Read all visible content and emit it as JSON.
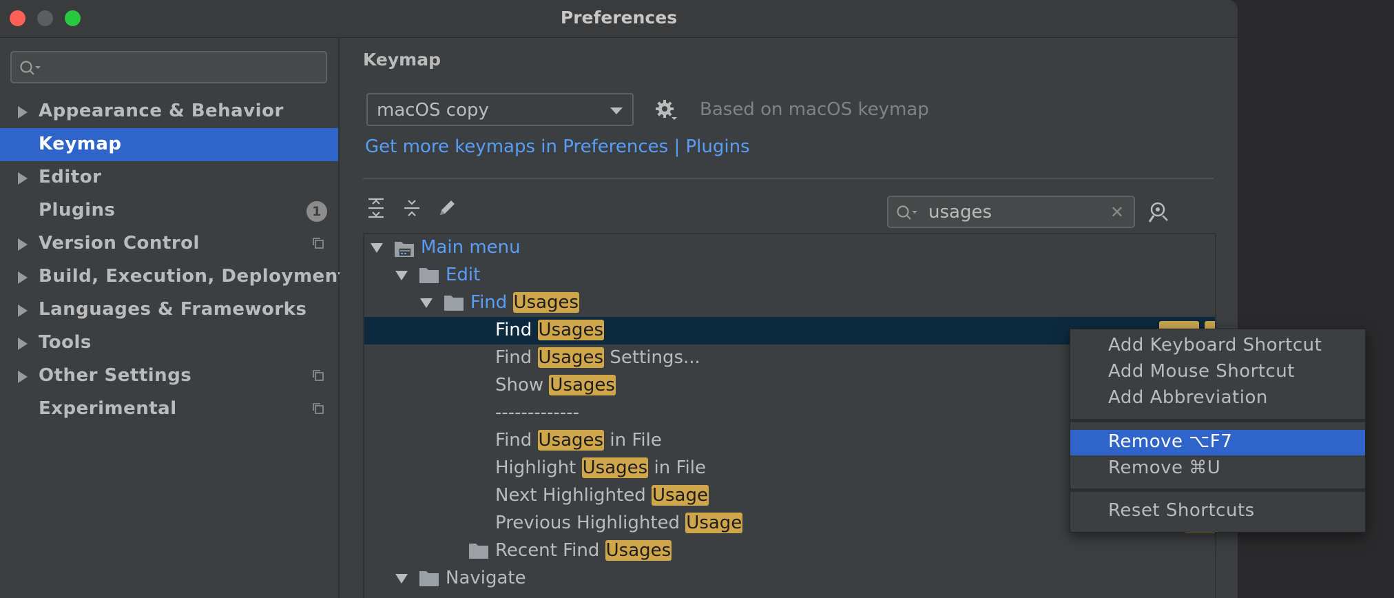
{
  "window": {
    "title": "Preferences"
  },
  "sidebar": {
    "search_placeholder": "",
    "items": [
      {
        "label": "Appearance & Behavior",
        "expandable": true
      },
      {
        "label": "Keymap",
        "selected": true
      },
      {
        "label": "Editor",
        "expandable": true
      },
      {
        "label": "Plugins",
        "badge": "1"
      },
      {
        "label": "Version Control",
        "expandable": true
      },
      {
        "label": "Build, Execution, Deployment",
        "expandable": true
      },
      {
        "label": "Languages & Frameworks",
        "expandable": true
      },
      {
        "label": "Tools",
        "expandable": true
      },
      {
        "label": "Other Settings",
        "expandable": true
      },
      {
        "label": "Experimental"
      }
    ]
  },
  "keymap": {
    "title": "Keymap",
    "scheme": "macOS copy",
    "based_on": "Based on macOS keymap",
    "link": "Get more keymaps in Preferences | Plugins",
    "search_value": "usages"
  },
  "tree": {
    "rows": [
      {
        "label": "Main menu"
      },
      {
        "label": "Edit"
      },
      {
        "pre": "Find ",
        "hl": "Usages",
        "post": ""
      },
      {
        "pre": "Find ",
        "hl": "Usages",
        "post": ""
      },
      {
        "pre": "Find ",
        "hl": "Usages",
        "post": " Settings..."
      },
      {
        "pre": "Show ",
        "hl": "Usages",
        "post": ""
      },
      {
        "label": "-------------"
      },
      {
        "pre": "Find ",
        "hl": "Usages",
        "post": " in File"
      },
      {
        "pre": "Highlight ",
        "hl": "Usages",
        "post": " in File"
      },
      {
        "pre": "Next Highlighted ",
        "hl": "Usage",
        "post": ""
      },
      {
        "pre": "Previous Highlighted ",
        "hl": "Usage",
        "post": ""
      },
      {
        "pre": "Recent Find ",
        "hl": "Usages",
        "post": ""
      },
      {
        "label": "Navigate"
      }
    ]
  },
  "context_menu": {
    "items": [
      "Add Keyboard Shortcut",
      "Add Mouse Shortcut",
      "Add Abbreviation",
      "Remove ⌥F7",
      "Remove ⌘U",
      "Reset Shortcuts"
    ],
    "selected": "Remove ⌥F7"
  },
  "colors": {
    "accent": "#2f65ca",
    "link": "#589df6",
    "highlight": "#cfa64a",
    "background": "#3c3f41"
  }
}
